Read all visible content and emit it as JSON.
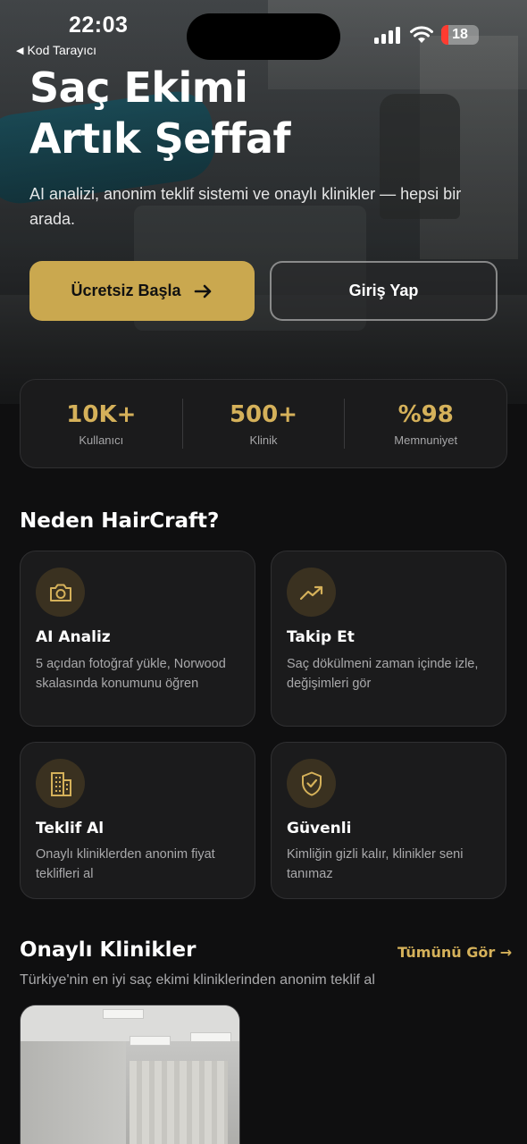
{
  "status_bar": {
    "time": "22:03",
    "back_label": "Kod Tarayıcı",
    "battery": 18,
    "battery_label": "18"
  },
  "hero": {
    "title_line1": "Saç Ekimi",
    "title_line2": "Artık Şeffaf",
    "subtitle": "AI analizi, anonim teklif sistemi ve onaylı klinikler — hepsi bir arada.",
    "primary_button": "Ücretsiz Başla",
    "secondary_button": "Giriş Yap"
  },
  "stats": [
    {
      "value": "10K+",
      "label": "Kullanıcı"
    },
    {
      "value": "500+",
      "label": "Klinik"
    },
    {
      "value": "%98",
      "label": "Memnuniyet"
    }
  ],
  "why": {
    "title": "Neden HairCraft?",
    "features": [
      {
        "icon": "camera-icon",
        "title": "AI Analiz",
        "desc": "5 açıdan fotoğraf yükle, Norwood skalasında konumunu öğren"
      },
      {
        "icon": "trending-up-icon",
        "title": "Takip Et",
        "desc": "Saç dökülmeni zaman içinde izle, değişimleri gör"
      },
      {
        "icon": "building-icon",
        "title": "Teklif Al",
        "desc": "Onaylı kliniklerden anonim fiyat teklifleri al"
      },
      {
        "icon": "shield-check-icon",
        "title": "Güvenli",
        "desc": "Kimliğin gizli kalır, klinikler seni tanımaz"
      }
    ]
  },
  "clinics": {
    "title": "Onaylı Klinikler",
    "see_all": "Tümünü Gör →",
    "subtitle": "Türkiye'nin en iyi saç ekimi kliniklerinden anonim teklif al"
  },
  "colors": {
    "accent": "#caa84f",
    "accent_text": "#d5b15a",
    "background": "#0f0f10",
    "card": "#1b1b1c"
  }
}
